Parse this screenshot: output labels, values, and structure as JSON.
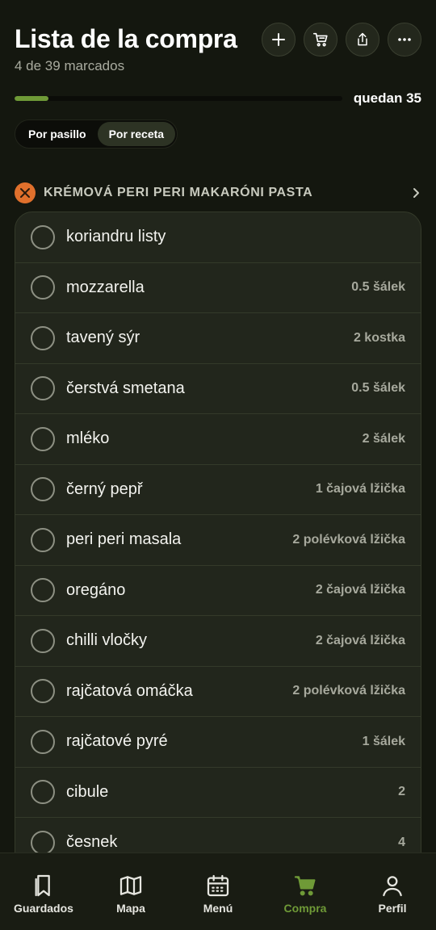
{
  "header": {
    "title": "Lista de la compra",
    "subtitle": "4 de 39 marcados",
    "actions": [
      "plus-icon",
      "cart-icon",
      "share-icon",
      "more-icon"
    ]
  },
  "progress": {
    "checked": 4,
    "total": 39,
    "fraction": 0.1026,
    "remaining_label": "quedan 35"
  },
  "view_toggle": {
    "options": [
      "Por pasillo",
      "Por receta"
    ],
    "selected": "Por receta"
  },
  "recipe": {
    "title": "KRÉMOVÁ PERI PERI MAKARÓNI PASTA",
    "icon": "utensils-icon"
  },
  "items": [
    {
      "name": "koriandru listy",
      "qty": ""
    },
    {
      "name": "mozzarella",
      "qty": "0.5 šálek"
    },
    {
      "name": "tavený sýr",
      "qty": "2 kostka"
    },
    {
      "name": "čerstvá smetana",
      "qty": "0.5 šálek"
    },
    {
      "name": "mléko",
      "qty": "2 šálek"
    },
    {
      "name": "černý pepř",
      "qty": "1 čajová lžička"
    },
    {
      "name": "peri peri masala",
      "qty": "2 polévková lžička"
    },
    {
      "name": "oregáno",
      "qty": "2 čajová lžička"
    },
    {
      "name": "chilli vločky",
      "qty": "2 čajová lžička"
    },
    {
      "name": "rajčatová omáčka",
      "qty": "2 polévková lžička"
    },
    {
      "name": "rajčatové pyré",
      "qty": "1 šálek"
    },
    {
      "name": "cibule",
      "qty": "2"
    },
    {
      "name": "česnek",
      "qty": "4"
    }
  ],
  "tabbar": {
    "tabs": [
      {
        "label": "Guardados",
        "icon": "bookmarks-icon"
      },
      {
        "label": "Mapa",
        "icon": "map-icon"
      },
      {
        "label": "Menú",
        "icon": "calendar-icon"
      },
      {
        "label": "Compra",
        "icon": "cart-icon"
      },
      {
        "label": "Perfil",
        "icon": "person-icon"
      }
    ],
    "active": "Compra"
  },
  "colors": {
    "accent": "#6f9a37",
    "background": "#14170f",
    "card": "#22261c",
    "recipe_badge": "#e0702c"
  }
}
